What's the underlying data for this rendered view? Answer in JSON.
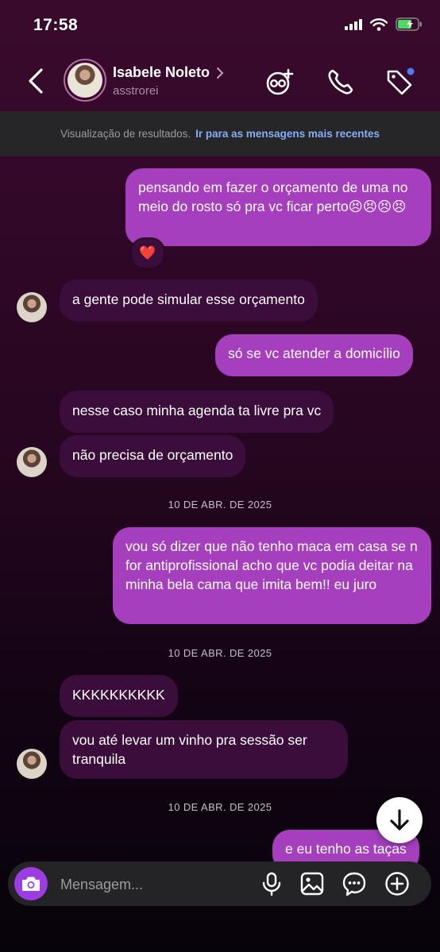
{
  "status_bar": {
    "time": "17:58"
  },
  "header": {
    "name": "Isabele Noleto",
    "username": "asstrorei",
    "icons": [
      "back-icon",
      "chevron-right-icon",
      "video-call-icon",
      "phone-icon",
      "tag-icon"
    ],
    "notification_dot_color": "#4f7bf7"
  },
  "banner": {
    "text": "Visualização de resultados.",
    "link": "Ir para as mensagens mais recentes"
  },
  "messages": [
    {
      "side": "outgoing",
      "text": "pensando em fazer o orçamento de uma no meio do rosto só pra vc ficar perto😣😣😣😣",
      "reaction": "❤️"
    },
    {
      "side": "incoming",
      "text": "a gente pode simular esse orçamento"
    },
    {
      "side": "outgoing",
      "text": "só se vc atender a domicílio"
    },
    {
      "side": "incoming",
      "text": "nesse caso minha agenda ta livre pra vc"
    },
    {
      "side": "incoming",
      "text": "não precisa de orçamento"
    },
    {
      "side": "date",
      "text": "10 DE ABR. DE 2025"
    },
    {
      "side": "outgoing",
      "text": "vou só dizer que não tenho maca em casa se n for antiprofissional acho que vc podia deitar na minha bela cama que imita bem!! eu juro"
    },
    {
      "side": "date",
      "text": "10 DE ABR. DE 2025"
    },
    {
      "side": "incoming",
      "text": "KKKKKKKKKK"
    },
    {
      "side": "incoming",
      "text": "vou até levar um vinho pra sessão ser tranquila"
    },
    {
      "side": "date",
      "text": "10 DE ABR. DE 2025"
    },
    {
      "side": "outgoing",
      "text": "e eu tenho as taças"
    }
  ],
  "composer": {
    "placeholder": "Mensagem...",
    "icons": [
      "camera-icon",
      "microphone-icon",
      "gallery-icon",
      "sticker-icon",
      "plus-icon"
    ]
  },
  "colors": {
    "outgoing_bubble": "#a53fbd",
    "incoming_bubble": "#3b0d3a",
    "camera_button": "#9b3de0",
    "link": "#86aef4"
  }
}
